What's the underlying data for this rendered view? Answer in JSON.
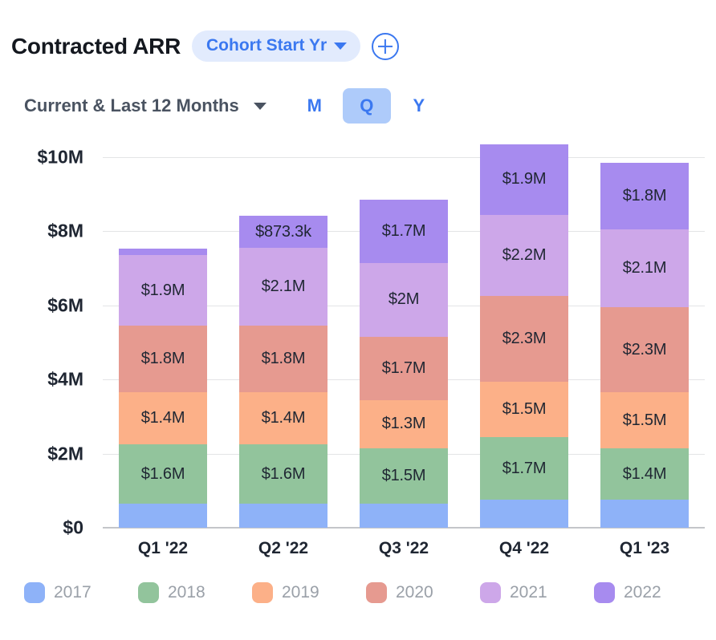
{
  "header": {
    "title": "Contracted ARR",
    "dimension_chip": {
      "label": "Cohort Start Yr",
      "icon": "chevron-down-icon"
    },
    "add_button": {
      "icon": "plus-circle-icon"
    }
  },
  "subheader": {
    "date_range": "Current & Last 12 Months",
    "date_range_icon": "chevron-down-icon",
    "granularity": {
      "options": [
        "M",
        "Q",
        "Y"
      ],
      "selected": "Q"
    }
  },
  "colors": {
    "2017": "#8eb2f8",
    "2018": "#92c49c",
    "2019": "#fcb088",
    "2020": "#e69a90",
    "2021": "#cda7e9",
    "2022": "#a78bef",
    "accent": "#3b78f0",
    "chip_bg": "#e2ebfd",
    "active_bg": "#aecbfa",
    "axis_text": "#1f2632",
    "legend_text": "#9aa0a8",
    "gridline": "#e3e4e6",
    "baseline": "#c4c6c9"
  },
  "chart_data": {
    "type": "bar",
    "stacked": true,
    "title": "Contracted ARR",
    "xlabel": "",
    "ylabel": "",
    "ylim": [
      0,
      10
    ],
    "yticks": [
      0,
      2,
      4,
      6,
      8,
      10
    ],
    "ytick_labels": [
      "$0",
      "$2M",
      "$4M",
      "$6M",
      "$8M",
      "$10M"
    ],
    "grid": true,
    "legend_position": "bottom",
    "categories": [
      "Q1 '22",
      "Q2 '22",
      "Q3 '22",
      "Q4 '22",
      "Q1 '23"
    ],
    "series": [
      {
        "name": "2017",
        "color": "#8eb2f8",
        "values": [
          0.65,
          0.65,
          0.65,
          0.75,
          0.75
        ],
        "labels": [
          "",
          "",
          "",
          "",
          ""
        ]
      },
      {
        "name": "2018",
        "color": "#92c49c",
        "values": [
          1.6,
          1.6,
          1.5,
          1.7,
          1.4
        ],
        "labels": [
          "$1.6M",
          "$1.6M",
          "$1.5M",
          "$1.7M",
          "$1.4M"
        ]
      },
      {
        "name": "2019",
        "color": "#fcb088",
        "values": [
          1.4,
          1.4,
          1.3,
          1.5,
          1.5
        ],
        "labels": [
          "$1.4M",
          "$1.4M",
          "$1.3M",
          "$1.5M",
          "$1.5M"
        ]
      },
      {
        "name": "2020",
        "color": "#e69a90",
        "values": [
          1.8,
          1.8,
          1.7,
          2.3,
          2.3
        ],
        "labels": [
          "$1.8M",
          "$1.8M",
          "$1.7M",
          "$2.3M",
          "$2.3M"
        ]
      },
      {
        "name": "2021",
        "color": "#cda7e9",
        "values": [
          1.9,
          2.1,
          2.0,
          2.2,
          2.1
        ],
        "labels": [
          "$1.9M",
          "$2.1M",
          "$2M",
          "$2.2M",
          "$2.1M"
        ]
      },
      {
        "name": "2022",
        "color": "#a78bef",
        "values": [
          0.18,
          0.8733,
          1.7,
          1.9,
          1.8
        ],
        "labels": [
          "",
          "$873.3k",
          "$1.7M",
          "$1.9M",
          "$1.8M"
        ]
      }
    ],
    "totals": [
      7.53,
      8.42,
      8.85,
      10.35,
      9.85
    ]
  },
  "legend": [
    {
      "label": "2017",
      "color": "#8eb2f8"
    },
    {
      "label": "2018",
      "color": "#92c49c"
    },
    {
      "label": "2019",
      "color": "#fcb088"
    },
    {
      "label": "2020",
      "color": "#e69a90"
    },
    {
      "label": "2021",
      "color": "#cda7e9"
    },
    {
      "label": "2022",
      "color": "#a78bef"
    }
  ]
}
